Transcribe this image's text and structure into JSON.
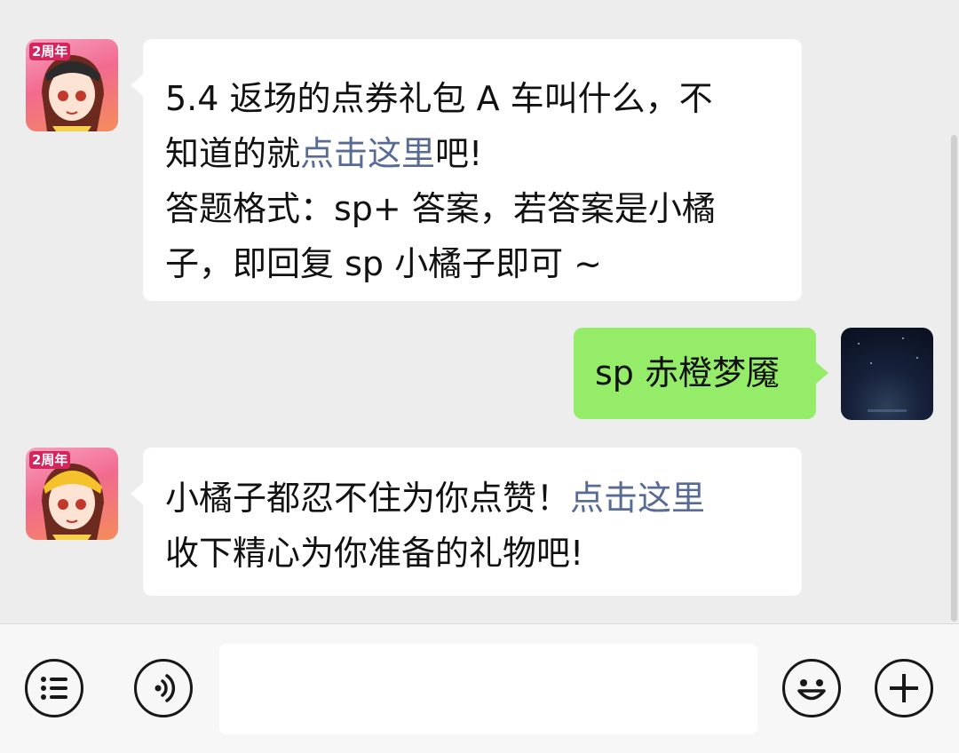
{
  "messages": [
    {
      "sender": "game-account",
      "side": "left",
      "line1": "5.4 返场的点券礼包 A 车叫什么，不",
      "line2_pre": "知道的就",
      "line2_link": "点击这里",
      "line2_post": "吧!",
      "line3": "答题格式：sp+ 答案，若答案是小橘",
      "line4": "子，即回复 sp 小橘子即可 ~"
    },
    {
      "sender": "me",
      "side": "right",
      "text": "sp 赤橙梦魇"
    },
    {
      "sender": "game-account",
      "side": "left",
      "line1_pre": "小橘子都忍不住为你点赞！",
      "line1_link": "点击这里",
      "line2": "收下精心为你准备的礼物吧!"
    }
  ],
  "avatar_badge": "2周年",
  "toolbar": {
    "menu_icon": "list-icon",
    "voice_icon": "voice-icon",
    "emoji_icon": "smile-icon",
    "more_icon": "plus-icon",
    "input_value": ""
  },
  "colors": {
    "background": "#ededed",
    "received_bubble": "#ffffff",
    "sent_bubble": "#95ec69",
    "link": "#576b95",
    "toolbar": "#f7f7f7"
  }
}
